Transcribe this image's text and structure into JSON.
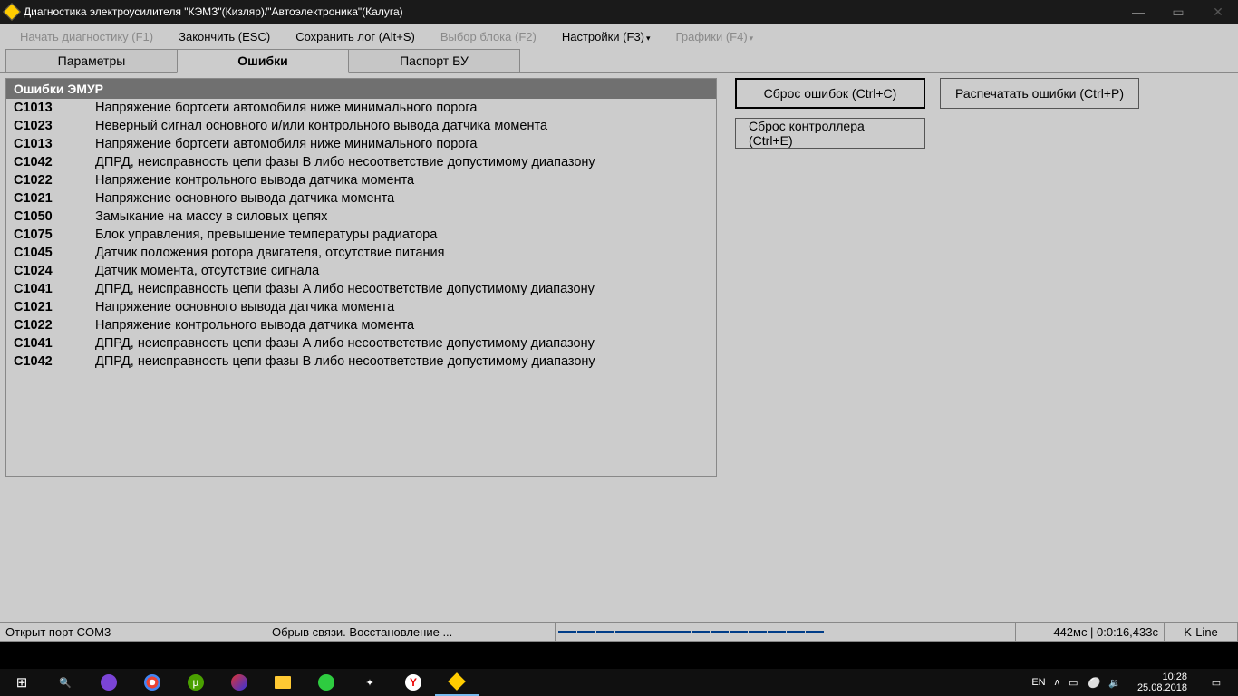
{
  "window": {
    "title": "Диагностика электроусилителя \"КЭМЗ\"(Кизляр)/\"Автоэлектроника\"(Калуга)"
  },
  "menu": {
    "start": "Начать диагностику (F1)",
    "finish": "Закончить (ESC)",
    "save_log": "Сохранить лог (Alt+S)",
    "select_block": "Выбор блока (F2)",
    "settings": "Настройки (F3)",
    "charts": "Графики (F4)"
  },
  "tabs": {
    "params": "Параметры",
    "errors": "Ошибки",
    "passport": "Паспорт БУ"
  },
  "errors": {
    "header": "Ошибки ЭМУР",
    "rows": [
      {
        "code": "C1013",
        "desc": "Напряжение бортсети автомобиля ниже минимального порога"
      },
      {
        "code": "C1023",
        "desc": "Неверный сигнал основного и/или контрольного вывода датчика момента"
      },
      {
        "code": "C1013",
        "desc": "Напряжение бортсети автомобиля ниже минимального порога"
      },
      {
        "code": "C1042",
        "desc": "ДПРД, неисправность цепи фазы B либо несоответствие допустимому диапазону"
      },
      {
        "code": "C1022",
        "desc": "Напряжение контрольного вывода датчика момента"
      },
      {
        "code": "C1021",
        "desc": "Напряжение основного вывода датчика момента"
      },
      {
        "code": "C1050",
        "desc": "Замыкание на массу в силовых цепях"
      },
      {
        "code": "C1075",
        "desc": "Блок управления, превышение температуры радиатора"
      },
      {
        "code": "C1045",
        "desc": "Датчик положения ротора двигателя, отсутствие питания"
      },
      {
        "code": "C1024",
        "desc": "Датчик момента, отсутствие сигнала"
      },
      {
        "code": "C1041",
        "desc": "ДПРД, неисправность цепи фазы A либо несоответствие допустимому диапазону"
      },
      {
        "code": "C1021",
        "desc": "Напряжение основного вывода датчика момента"
      },
      {
        "code": "C1022",
        "desc": "Напряжение контрольного вывода датчика момента"
      },
      {
        "code": "C1041",
        "desc": "ДПРД, неисправность цепи фазы A либо несоответствие допустимому диапазону"
      },
      {
        "code": "C1042",
        "desc": "ДПРД, неисправность цепи фазы B либо несоответствие допустимому диапазону"
      }
    ]
  },
  "buttons": {
    "clear_errors": "Сброс ошибок (Ctrl+C)",
    "print_errors": "Распечатать ошибки (Ctrl+P)",
    "reset_controller": "Сброс контроллера (Ctrl+E)"
  },
  "status": {
    "port": "Открыт порт COM3",
    "conn": "Обрыв связи. Восстановление ...",
    "time": "442мс | 0:0:16,433с",
    "kline": "K-Line"
  },
  "taskbar": {
    "lang": "EN",
    "time": "10:28",
    "date": "25.08.2018"
  }
}
